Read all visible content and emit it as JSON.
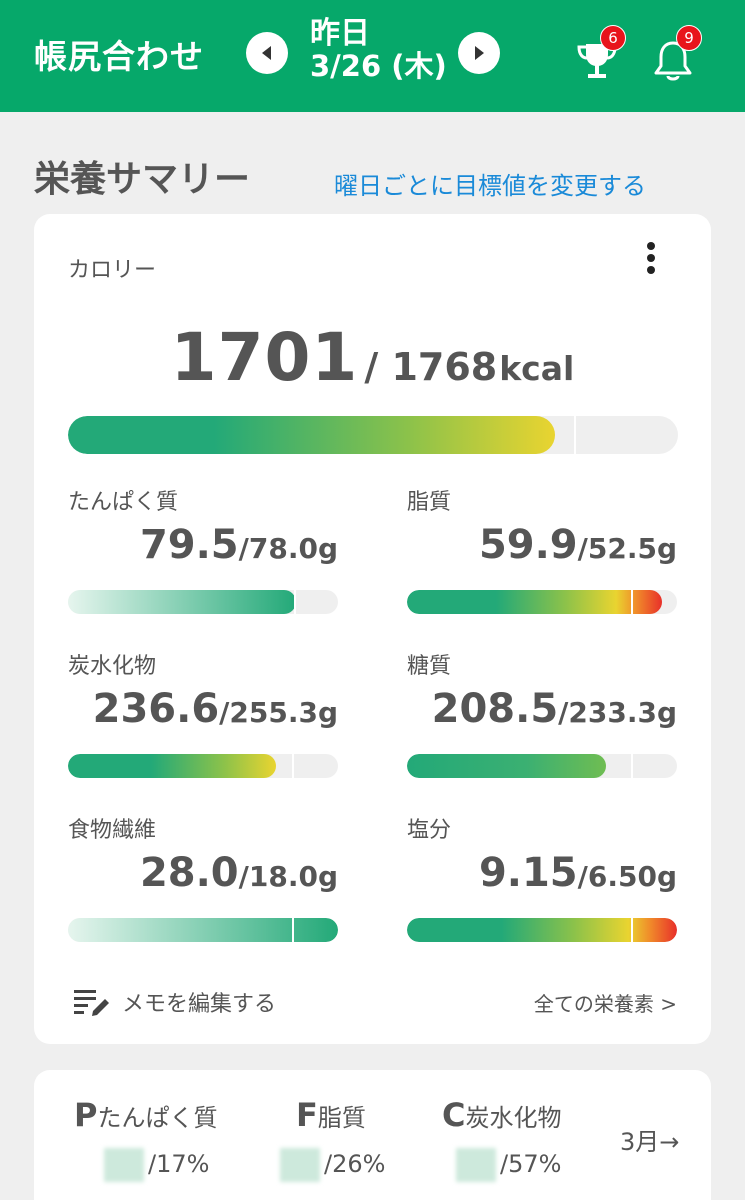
{
  "header": {
    "title": "帳尻合わせ",
    "day_label": "昨日",
    "date_label": "3/26 (木)",
    "trophy_badge": "6",
    "bell_badge": "9",
    "color": "#06a86a"
  },
  "section": {
    "title": "栄養サマリー",
    "link": "曜日ごとに目標値を変更する"
  },
  "calorie": {
    "label": "カロリー",
    "value": "1701",
    "target": "/ 1768",
    "unit": "kcal",
    "progress": 0.962
  },
  "nutrients": [
    {
      "name": "たんぱく質",
      "value": "79.5",
      "target": "/78.0g",
      "progress": 1.02
    },
    {
      "name": "脂質",
      "value": "59.9",
      "target": "/52.5g",
      "progress": 1.14
    },
    {
      "name": "炭水化物",
      "value": "236.6",
      "target": "/255.3g",
      "progress": 0.93
    },
    {
      "name": "糖質",
      "value": "208.5",
      "target": "/233.3g",
      "progress": 0.89
    },
    {
      "name": "食物繊維",
      "value": "28.0",
      "target": "/18.0g",
      "progress": 1.56
    },
    {
      "name": "塩分",
      "value": "9.15",
      "target": "/6.50g",
      "progress": 1.41
    }
  ],
  "memo_label": "メモを編集する",
  "all_nutrients_link": "全ての栄養素 >",
  "pfc": {
    "p_letter": "P",
    "p_label": "たんぱく質",
    "p_pct": "/17%",
    "f_letter": "F",
    "f_label": "脂質",
    "f_pct": "/26%",
    "c_letter": "C",
    "c_label": "炭水化物",
    "c_pct": "/57%",
    "month_link": "3月→"
  }
}
